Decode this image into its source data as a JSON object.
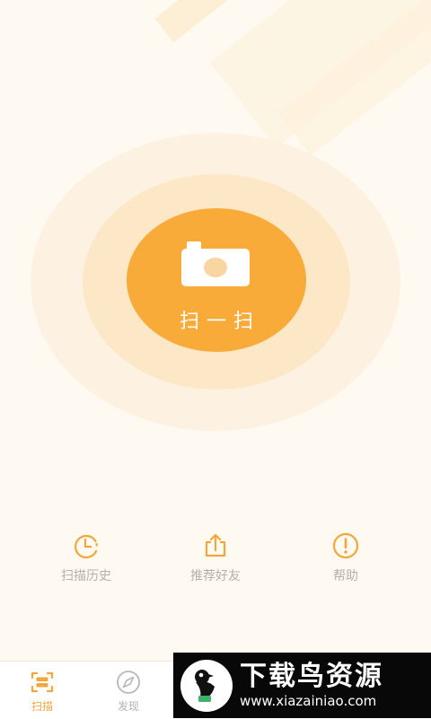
{
  "scan": {
    "label": "扫一扫"
  },
  "shortcuts": [
    {
      "label": "扫描历史",
      "icon": "history-clock-icon"
    },
    {
      "label": "推荐好友",
      "icon": "share-icon"
    },
    {
      "label": "帮助",
      "icon": "help-exclamation-icon"
    }
  ],
  "tabs": [
    {
      "label": "扫描",
      "icon": "scan-icon",
      "active": true
    },
    {
      "label": "发现",
      "icon": "compass-icon",
      "active": false
    }
  ],
  "watermark": {
    "title": "下载鸟资源",
    "url": "www.xiazainiao.com"
  },
  "colors": {
    "accent": "#f9ab3a",
    "background": "#fefaf2",
    "muted_text": "#b6b0a8",
    "tab_inactive": "#b1b1b1"
  }
}
